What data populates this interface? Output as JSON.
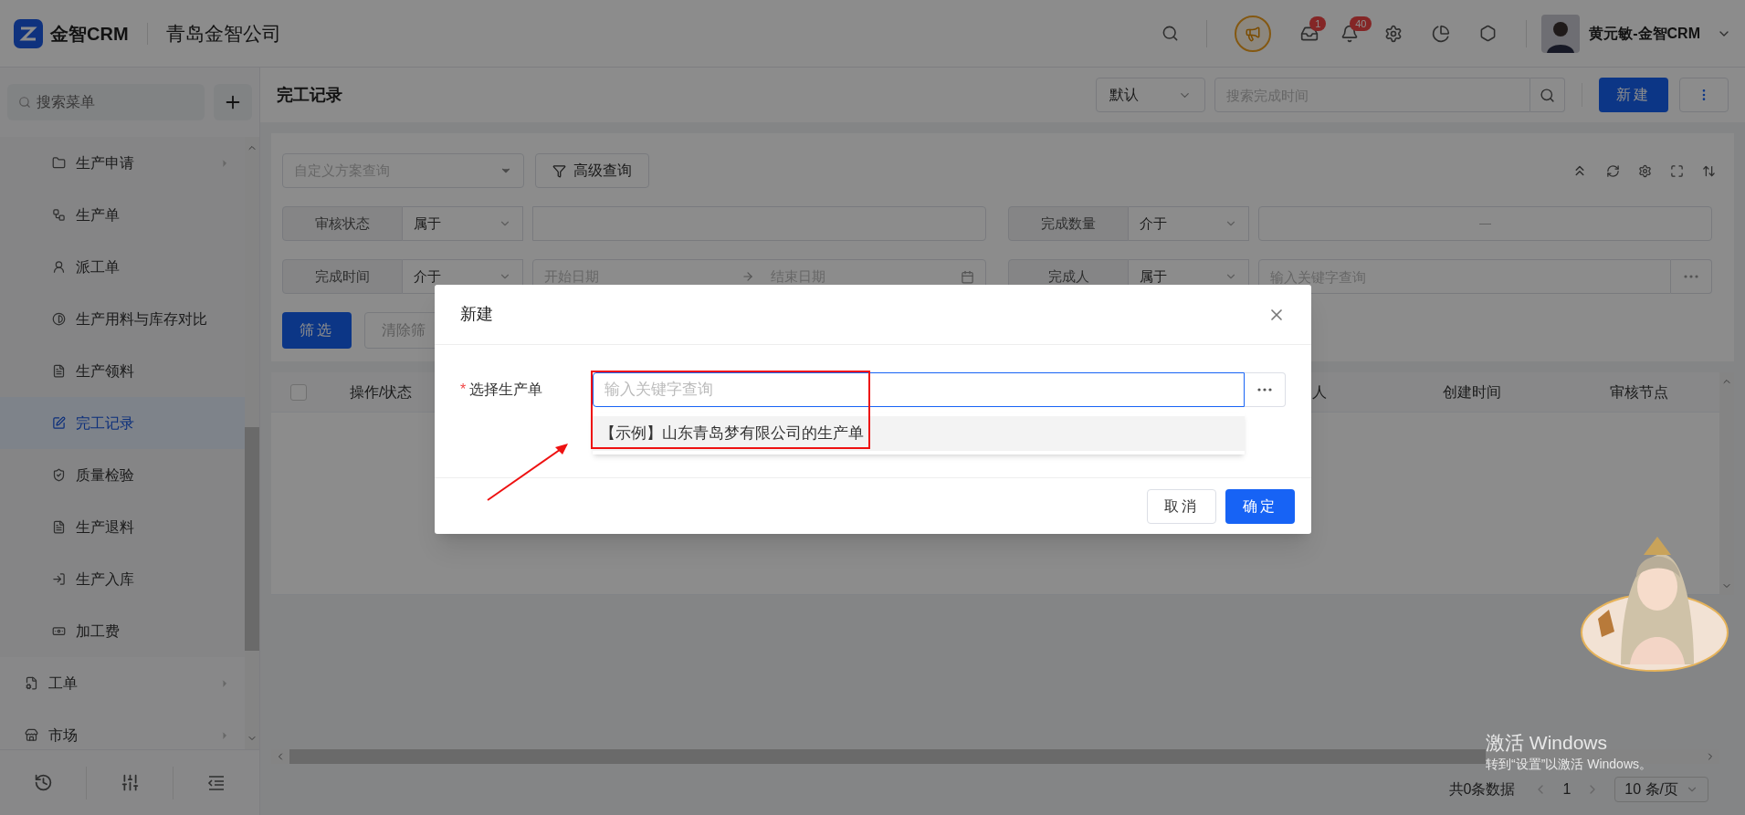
{
  "topbar": {
    "logo_text": "金智CRM",
    "company": "青岛金智公司",
    "badges": [
      {
        "kind": "tasks",
        "count": "1"
      },
      {
        "kind": "bell",
        "count": "40"
      }
    ],
    "user": "黄元敏-金智CRM"
  },
  "sidebar": {
    "search_placeholder": "搜索菜单",
    "menu": [
      {
        "children": [
          {
            "label": "生产申请",
            "expandable": true,
            "selected": false
          },
          {
            "label": "生产单",
            "expandable": false,
            "selected": false
          },
          {
            "label": "派工单",
            "expandable": false,
            "selected": false
          },
          {
            "label": "生产用料与库存对比",
            "expandable": false,
            "selected": false
          },
          {
            "label": "生产领料",
            "expandable": false,
            "selected": false
          },
          {
            "label": "完工记录",
            "expandable": false,
            "selected": true
          },
          {
            "label": "质量检验",
            "expandable": false,
            "selected": false
          },
          {
            "label": "生产退料",
            "expandable": false,
            "selected": false
          },
          {
            "label": "生产入库",
            "expandable": false,
            "selected": false
          },
          {
            "label": "加工费",
            "expandable": false,
            "selected": false
          }
        ]
      },
      {
        "label": "工单",
        "expandable": true,
        "selected": false
      },
      {
        "label": "市场",
        "expandable": true,
        "selected": false
      }
    ]
  },
  "header": {
    "title": "完工记录",
    "view": "默认",
    "search_placeholder": "搜索完成时间",
    "new_button": "新建"
  },
  "filters": {
    "scheme_placeholder": "自定义方案查询",
    "advanced_button": "高级查询",
    "fields": [
      {
        "label": "审核状态",
        "operator": "属于",
        "kind": "text"
      },
      {
        "label": "完成数量",
        "operator": "介于",
        "kind": "range",
        "separator": "—"
      },
      {
        "label": "完成时间",
        "operator": "介于",
        "kind": "date_range",
        "start_placeholder": "开始日期",
        "end_placeholder": "结束日期"
      },
      {
        "label": "完成人",
        "operator": "属于",
        "kind": "keyword",
        "placeholder": "输入关键字查询"
      }
    ],
    "apply_button": "筛选",
    "clear_button": "清除筛"
  },
  "table": {
    "select_all_checked": false,
    "columns": [
      {
        "label": "操作/状态"
      },
      {
        "label": "人"
      },
      {
        "label": "创建时间"
      },
      {
        "label": "审核节点"
      }
    ]
  },
  "pagination": {
    "total": "共0条数据",
    "page": "1",
    "page_size": "10 条/页"
  },
  "windows_activation": {
    "title": "激活 Windows",
    "subtitle": "转到“设置”以激活 Windows。"
  },
  "dialog": {
    "title": "新建",
    "required_mark": "*",
    "field_label": "选择生产单",
    "placeholder": "输入关键字查询",
    "options": [
      {
        "label": "【示例】山东青岛梦有限公司的生产单",
        "highlighted": true
      }
    ],
    "cancel": "取消",
    "confirm": "确定"
  }
}
